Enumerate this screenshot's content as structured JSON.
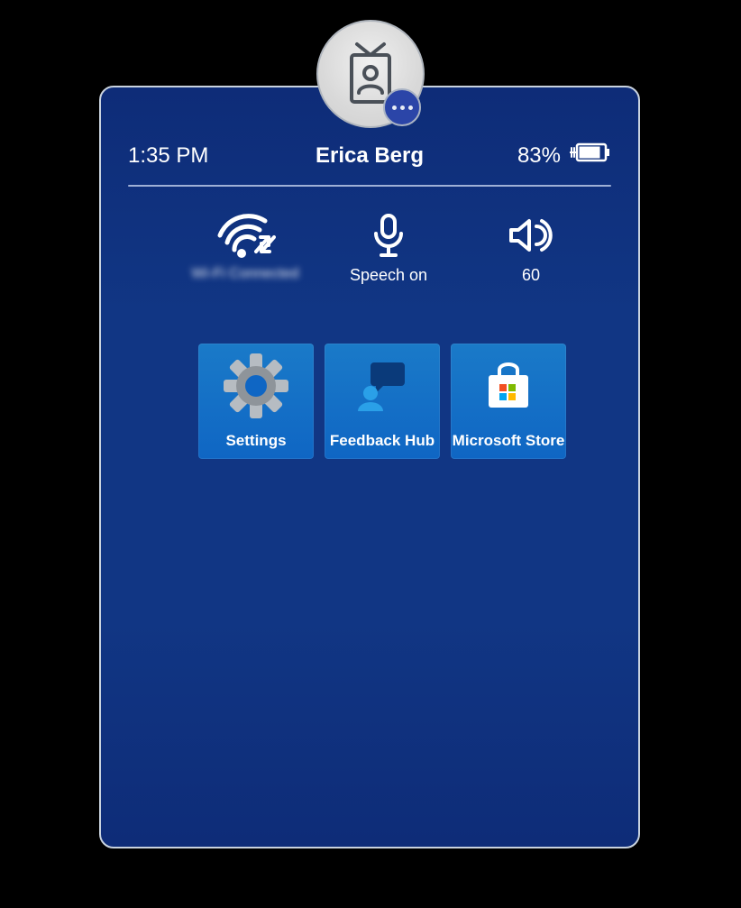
{
  "statusbar": {
    "time": "1:35 PM",
    "username": "Erica Berg",
    "battery_percent": "83%"
  },
  "quick": {
    "wifi_label": "Wi-Fi Connected",
    "speech_label": "Speech on",
    "volume_label": "60"
  },
  "tiles": [
    {
      "label": "Settings"
    },
    {
      "label": "Feedback Hub"
    },
    {
      "label": "Microsoft Store"
    }
  ],
  "colors": {
    "panel_bg": "#113684",
    "tile_bg": "#1473c8",
    "accent": "#2b45a8"
  }
}
